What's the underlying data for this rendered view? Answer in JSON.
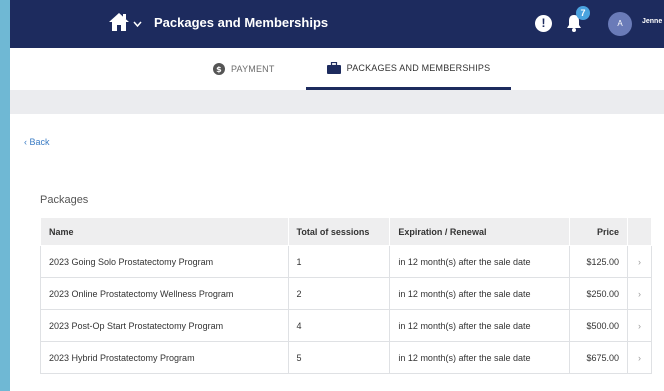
{
  "header": {
    "title": "Packages and Memberships",
    "notification_count": "7",
    "avatar_initial": "A",
    "username": "Jenne",
    "alert_glyph": "!"
  },
  "tabs": [
    {
      "label": "PAYMENT",
      "icon": "dollar-circle-icon",
      "active": false
    },
    {
      "label": "PACKAGES AND MEMBERSHIPS",
      "icon": "briefcase-icon",
      "active": true
    }
  ],
  "back_link": "‹ Back",
  "packages": {
    "section_title": "Packages",
    "columns": [
      "Name",
      "Total of sessions",
      "Expiration / Renewal",
      "Price"
    ],
    "rows": [
      {
        "name": "2023 Going Solo Prostatectomy Program",
        "sessions": "1",
        "expiration": "in 12 month(s) after the sale date",
        "price": "$125.00"
      },
      {
        "name": "2023 Online Prostatectomy Wellness Program",
        "sessions": "2",
        "expiration": "in 12 month(s) after the sale date",
        "price": "$250.00"
      },
      {
        "name": "2023 Post-Op Start Prostatectomy Program",
        "sessions": "4",
        "expiration": "in 12 month(s) after the sale date",
        "price": "$500.00"
      },
      {
        "name": "2023 Hybrid Prostatectomy Program",
        "sessions": "5",
        "expiration": "in 12 month(s) after the sale date",
        "price": "$675.00"
      }
    ]
  },
  "colors": {
    "header_bg": "#1d2b5e",
    "accent": "#4aa3df",
    "frame": "#6fb8d4"
  }
}
